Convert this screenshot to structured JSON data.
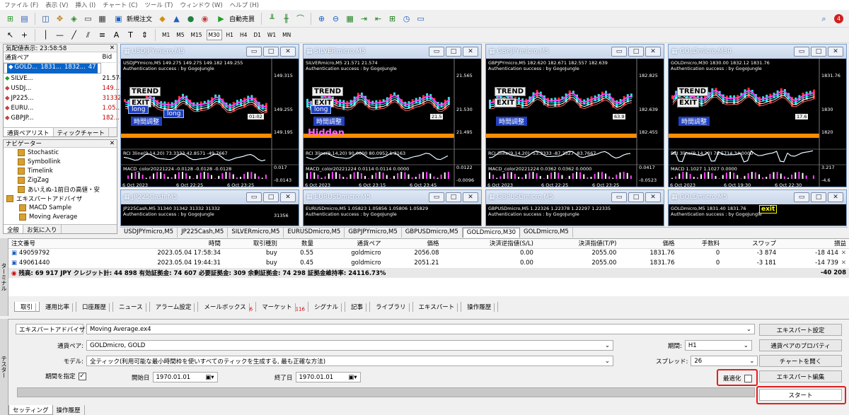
{
  "menu": [
    "ファイル (F)",
    "表示 (V)",
    "挿入 (I)",
    "チャート (C)",
    "ツール (T)",
    "ウィンドウ (W)",
    "ヘルプ (H)"
  ],
  "toolbar": {
    "new_order": "新規注文",
    "auto_trade": "自動売買"
  },
  "timeframes": [
    "M1",
    "M5",
    "M15",
    "M30",
    "H1",
    "H4",
    "D1",
    "W1",
    "MN"
  ],
  "active_timeframe": "M30",
  "tray": {
    "badge": "4"
  },
  "market_watch": {
    "title": "気配値表示: 23:58:58",
    "headers": [
      "通貨ペア",
      "Bid",
      "Ask",
      "!"
    ],
    "rows": [
      {
        "symbol": "GOLD...",
        "bid": "1831...",
        "ask": "1832...",
        "spread": "47",
        "selected": true
      },
      {
        "symbol": "SILVE...",
        "bid": "21.574",
        "ask": "21.616",
        "spread": "42",
        "selected": false
      },
      {
        "symbol": "USDJ...",
        "bid": "149....",
        "ask": "149....",
        "spread": "",
        "selected": false
      },
      {
        "symbol": "JP225...",
        "bid": "31332",
        "ask": "31339",
        "spread": "7",
        "selected": false
      },
      {
        "symbol": "EURU...",
        "bid": "1.05...",
        "ask": "1.05...",
        "spread": "70",
        "selected": false
      },
      {
        "symbol": "GBPJP...",
        "bid": "182...",
        "ask": "182...",
        "spread": "",
        "selected": false
      }
    ],
    "tabs": [
      "通貨ペアリスト",
      "ティックチャート"
    ]
  },
  "navigator": {
    "title": "ナビゲーター",
    "items": [
      "Stochastic",
      "Symbollink",
      "Timelink",
      "ZigZag",
      "あいえぬ-1前日の高値・安",
      "エキスパートアドバイザ",
      "MACD Sample",
      "Moving Average"
    ],
    "tabs": [
      "全般",
      "お気に入り"
    ]
  },
  "charts": [
    {
      "title": "USDJPYmicro,M5",
      "info": "USDJPYmicro,M5  149.275 149.275 149.182 149.255",
      "auth": "Authentication success : by GogoJungle",
      "p1": "149.315",
      "p2": "149.255",
      "p3": "149.195",
      "p4": "0.017",
      "p5": "-0.0143",
      "rci": "RCI 3line(9,14,20) 73.3333 42.8571 -49.7667",
      "macd": "MACD_color20221224 -0.0128 -0.0128 -0.0128",
      "d1": "6 Oct 2023",
      "d2": "6 Oct 22:25",
      "d3": "6 Oct 23:25",
      "l1": "long",
      "l2": "long",
      "trend": "TREND",
      "exit": "EXIT",
      "time": "時間調整",
      "extra": "01:02"
    },
    {
      "title": "SILVERmicro,M5",
      "info": "SILVERmicro,M5  21.571 21.574",
      "auth": "Authentication success : by GogoJungle",
      "p1": "21.565",
      "p2": "21.530",
      "p3": "21.495",
      "p4": "0.0122",
      "p5": "-0.0096",
      "rci": "RCI 3line(9,14,20) 90.0000 80.0952 1.3163",
      "macd": "MACD_color20221224 0.0114 0.0114 0.0000",
      "d1": "6 Oct 2023",
      "d2": "6 Oct 23:15",
      "d3": "6 Oct 23:45",
      "l1": "long",
      "l2": "Hidden",
      "trend": "TREND",
      "exit": "EXIT",
      "time": "時間調整",
      "extra": "21.5"
    },
    {
      "title": "GBPJPYmicro,M5",
      "info": "GBPJPYmicro,M5  182.620 182.671 182.557 182.639",
      "auth": "Authentication success : by GogoJungle",
      "p1": "182.825",
      "p2": "182.639",
      "p3": "182.455",
      "p4": "0.0417",
      "p5": "-0.0523",
      "rci": "RCI 3line(9,14,20) -53.3333 -87.2527 -83.7667",
      "macd": "MACD_color20221224 0.0362 0.0362 0.0000",
      "d1": "6 Oct 2023",
      "d2": "6 Oct 22:25",
      "d3": "6 Oct 23:25",
      "l1": "",
      "l2": "",
      "trend": "TREND",
      "exit": "EXIT",
      "time": "時間調整",
      "extra": "63.9"
    },
    {
      "title": "GOLDmicro,M30",
      "info": "GOLDmicro,M30  1830.00 1832.12 1831.76",
      "auth": "Authentication success : by GogoJungle",
      "p1": "1831.76",
      "p2": "1830",
      "p3": "1820",
      "p4": "3.217",
      "p5": "-4.6",
      "rci": "RCI 3line(9,14,20) 78.5714 34.0000",
      "macd": "MACD 1.1027 1.1027 0.0000",
      "d1": "6 Oct 2023",
      "d2": "6 Oct 19:30",
      "d3": "6 Oct 22:30",
      "l1": "",
      "l2": "",
      "trend": "TREND",
      "exit": "EXIT",
      "time": "時間調整",
      "extra": "17.6"
    }
  ],
  "bottom_charts": [
    {
      "title": "JP225Cash,M5",
      "info": "JP225Cash,M5  31340 31342 31332 31332",
      "auth": "Authentication success : by GogoJungle",
      "p1": "31356"
    },
    {
      "title": "EURUSDmicro,M5",
      "info": "EURUSDmicro,M5  1.05823 1.05856 1.05806 1.05829",
      "auth": "Authentication success : by GogoJungle",
      "p1": ""
    },
    {
      "title": "GBPUSDmicro,M5",
      "info": "GBPUSDmicro,M5  1.22326 1.22378 1.22297 1.22335",
      "auth": "Authentication success : by GogoJungle",
      "p1": ""
    },
    {
      "title": "GOLDmicro,M5",
      "info": "GOLDmicro,M5  1831.40 1831.76",
      "auth": "Authentication success : by GogoJungle",
      "p1": "exit"
    }
  ],
  "chart_tabs": [
    "USDJPYmicro,M5",
    "JP225Cash,M5",
    "SILVERmicro,M5",
    "EURUSDmicro,M5",
    "GBPJPYmicro,M5",
    "GBPUSDmicro,M5",
    "GOLDmicro,M30",
    "GOLDmicro,M5"
  ],
  "active_chart_tab": "GOLDmicro,M30",
  "terminal": {
    "headers": [
      "注文番号",
      "時間",
      "取引種別",
      "数量",
      "通貨ペア",
      "価格",
      "決済逆指値(S/L)",
      "決済指値(T/P)",
      "価格",
      "手数料",
      "スワップ",
      "損益"
    ],
    "rows": [
      [
        "49059792",
        "2023.05.04 17:58:34",
        "buy",
        "0.55",
        "goldmicro",
        "2056.08",
        "0.00",
        "2055.00",
        "1831.76",
        "0",
        "-3 874",
        "-18 414"
      ],
      [
        "49061440",
        "2023.05.04 19:44:31",
        "buy",
        "0.45",
        "goldmicro",
        "2051.21",
        "0.00",
        "2055.00",
        "1831.76",
        "0",
        "-3 181",
        "-14 739"
      ]
    ],
    "summary": "残高: 69 917 JPY  クレジット計: 44 898  有効証拠金: 74 607  必要証拠金: 309  余剰証拠金: 74 298  証拠金維持率: 24116.73%",
    "total": "-40 208",
    "tabs": [
      "取引",
      "運用比率",
      "口座履歴",
      "ニュース",
      "アラーム設定",
      "メールボックス",
      "マーケット",
      "シグナル",
      "記事",
      "ライブラリ",
      "エキスパート",
      "操作履歴"
    ],
    "mail_count": "6",
    "market_count": "116",
    "side_label": "ターミナル"
  },
  "tester": {
    "ea_select_label": "エキスパートアドバイザ",
    "ea_value": "Moving Average.ex4",
    "symbol_label": "通貨ペア:",
    "symbol_value": "GOLDmicro, GOLD",
    "model_label": "モデル:",
    "model_value": "全ティック(利用可能な最小時間枠を使いすべてのティックを生成する, 最も正確な方法)",
    "period_check_label": "期間を指定",
    "start_label": "開始日",
    "start_value": "1970.01.01",
    "end_label": "終了日",
    "end_value": "1970.01.01",
    "timeframe_label": "期間:",
    "timeframe_value": "H1",
    "spread_label": "スプレッド:",
    "spread_value": "26",
    "optimize_label": "最適化",
    "buttons": [
      "エキスパート設定",
      "通貨ペアのプロパティ",
      "チャートを開く",
      "エキスパート編集"
    ],
    "start_button": "スタート",
    "tabs": [
      "セッティング",
      "操作履歴"
    ],
    "side_label": "テスター"
  }
}
